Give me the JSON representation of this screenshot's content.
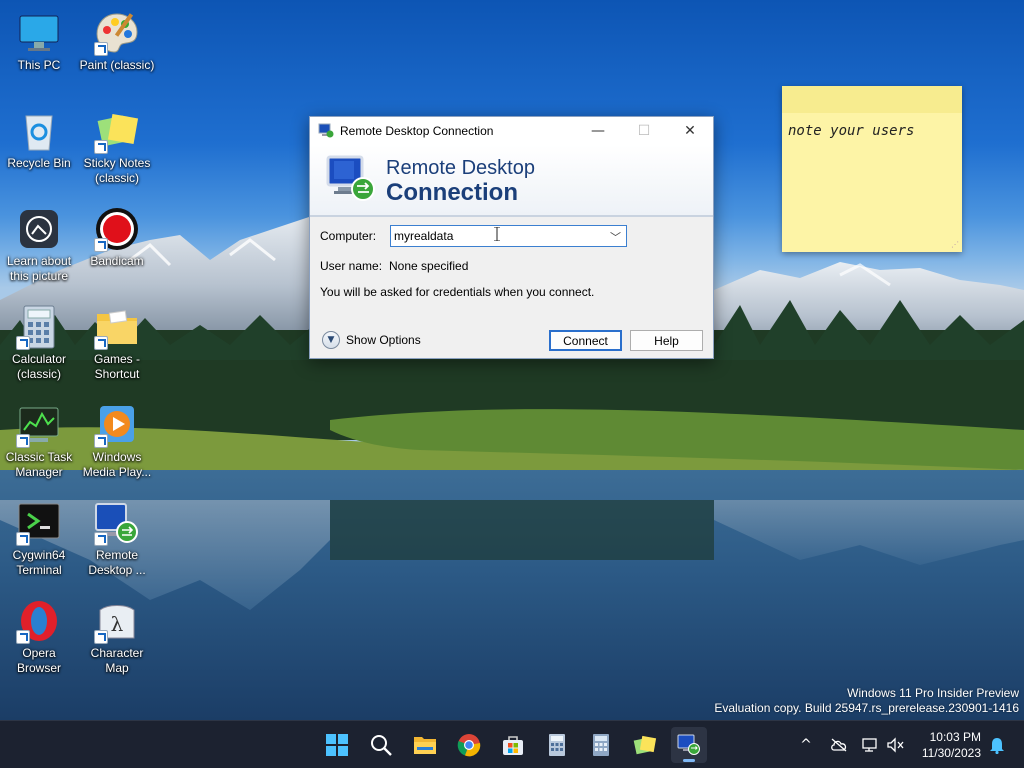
{
  "desktop": {
    "icons": [
      {
        "label": "This PC",
        "icon": "monitor-icon"
      },
      {
        "label": "Paint (classic)",
        "icon": "paint-palette-icon"
      },
      {
        "label": "Recycle Bin",
        "icon": "recycle-bin-icon"
      },
      {
        "label": "Sticky Notes\n(classic)",
        "icon": "sticky-notes-icon"
      },
      {
        "label": "Learn about\nthis picture",
        "icon": "camera-icon"
      },
      {
        "label": "Bandicam",
        "icon": "record-icon"
      },
      {
        "label": "Calculator\n(classic)",
        "icon": "calculator-icon"
      },
      {
        "label": "Games -\nShortcut",
        "icon": "folder-icon"
      },
      {
        "label": "Classic Task\nManager",
        "icon": "task-manager-icon"
      },
      {
        "label": "Windows\nMedia Play...",
        "icon": "media-player-icon"
      },
      {
        "label": "Cygwin64\nTerminal",
        "icon": "terminal-icon"
      },
      {
        "label": "Remote\nDesktop ...",
        "icon": "remote-desktop-icon"
      },
      {
        "label": "Opera\nBrowser",
        "icon": "opera-icon"
      },
      {
        "label": "Character\nMap",
        "icon": "character-map-icon"
      }
    ]
  },
  "sticky_note": {
    "text": "note your users",
    "color": "#fdf4a6"
  },
  "dialog": {
    "title": "Remote Desktop Connection",
    "banner_line1": "Remote Desktop",
    "banner_line2": "Connection",
    "computer_label": "Computer:",
    "computer_value": "myrealdata",
    "username_label": "User name:",
    "username_value": "None specified",
    "info_text": "You will be asked for credentials when you connect.",
    "show_options": "Show Options",
    "connect_label": "Connect",
    "help_label": "Help",
    "controls": {
      "minimize": "—",
      "maximize": "☐",
      "close": "✕"
    }
  },
  "watermark": {
    "line1": "Windows 11 Pro Insider Preview",
    "line2": "Evaluation copy. Build 25947.rs_prerelease.230901-1416"
  },
  "taskbar": {
    "apps": [
      "start-icon",
      "search-icon",
      "file-explorer-icon",
      "chrome-icon",
      "store-icon",
      "calculator-icon",
      "calculator-classic-icon",
      "sticky-notes-icon",
      "remote-desktop-icon"
    ],
    "active_app": "remote-desktop-icon",
    "tray": {
      "chevron": "^",
      "time": "10:03 PM",
      "date": "11/30/2023"
    }
  },
  "colors": {
    "taskbar": "#1c2230",
    "accent": "#2a6fcc",
    "banner_text": "#1b3f7a"
  }
}
